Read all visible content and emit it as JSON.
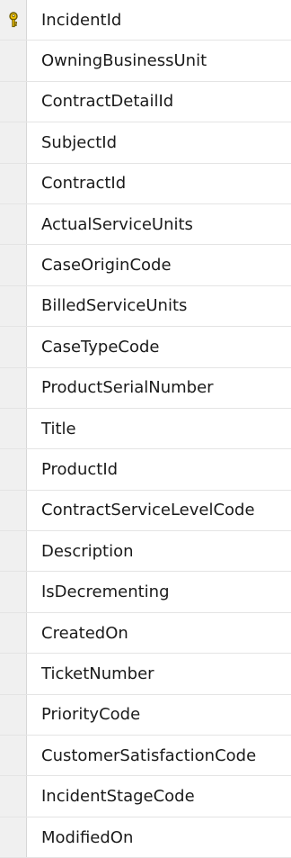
{
  "columns": [
    {
      "name": "IncidentId",
      "primary_key": true,
      "row_header_icon": "primary-key-icon"
    },
    {
      "name": "OwningBusinessUnit"
    },
    {
      "name": "ContractDetailId"
    },
    {
      "name": "SubjectId"
    },
    {
      "name": "ContractId"
    },
    {
      "name": "ActualServiceUnits"
    },
    {
      "name": "CaseOriginCode"
    },
    {
      "name": "BilledServiceUnits"
    },
    {
      "name": "CaseTypeCode"
    },
    {
      "name": "ProductSerialNumber"
    },
    {
      "name": "Title"
    },
    {
      "name": "ProductId"
    },
    {
      "name": "ContractServiceLevelCode"
    },
    {
      "name": "Description"
    },
    {
      "name": "IsDecrementing"
    },
    {
      "name": "CreatedOn"
    },
    {
      "name": "TicketNumber"
    },
    {
      "name": "PriorityCode"
    },
    {
      "name": "CustomerSatisfactionCode"
    },
    {
      "name": "IncidentStageCode"
    },
    {
      "name": "ModifiedOn"
    }
  ],
  "colors": {
    "row_header_bg": "#f0f0f0",
    "grid_line": "#e4e4e4",
    "key_icon_fill": "#f2c200",
    "key_icon_outline": "#6b5a00"
  }
}
